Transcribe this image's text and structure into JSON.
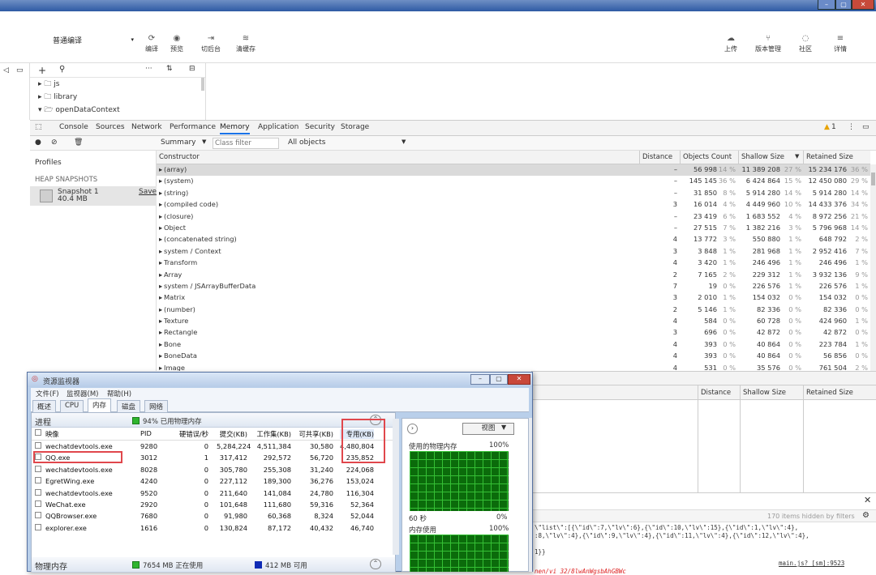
{
  "titlebar": {
    "min": "–",
    "max": "▢",
    "close": "✕"
  },
  "toolbar": {
    "compile_mode": "普通编译",
    "buttons": [
      {
        "label": "编译",
        "icon": "refresh-icon"
      },
      {
        "label": "预览",
        "icon": "eye-icon"
      },
      {
        "label": "切后台",
        "icon": "switch-icon"
      },
      {
        "label": "清缓存",
        "icon": "layers-icon"
      }
    ],
    "right_buttons": [
      {
        "label": "上传",
        "icon": "cloud-upload-icon"
      },
      {
        "label": "版本管理",
        "icon": "branch-icon"
      },
      {
        "label": "社区",
        "icon": "chat-icon"
      },
      {
        "label": "详情",
        "icon": "menu-icon"
      }
    ]
  },
  "filetree": {
    "items": [
      "js",
      "library",
      "openDataContext"
    ]
  },
  "devtools": {
    "tabs": [
      "Console",
      "Sources",
      "Network",
      "Performance",
      "Memory",
      "Application",
      "Security",
      "Storage"
    ],
    "active_tab": "Memory",
    "warnings": "1"
  },
  "profiles": {
    "title": "Profiles",
    "section": "HEAP SNAPSHOTS",
    "snapshot_name": "Snapshot 1",
    "snapshot_size": "40.4 MB",
    "save": "Save"
  },
  "filter": {
    "view": "Summary",
    "placeholder": "Class filter",
    "objects": "All objects"
  },
  "heap": {
    "headers": [
      "Constructor",
      "Distance",
      "Objects Count",
      "Shallow Size",
      "Retained Size"
    ],
    "rows": [
      [
        "(array)",
        "–",
        "56 998",
        "14 %",
        "11 389 208",
        "27 %",
        "15 234 176",
        "36 %"
      ],
      [
        "(system)",
        "–",
        "145 145",
        "36 %",
        "6 424 864",
        "15 %",
        "12 450 080",
        "29 %"
      ],
      [
        "(string)",
        "–",
        "31 850",
        "8 %",
        "5 914 280",
        "14 %",
        "5 914 280",
        "14 %"
      ],
      [
        "(compiled code)",
        "3",
        "16 014",
        "4 %",
        "4 449 960",
        "10 %",
        "14 433 376",
        "34 %"
      ],
      [
        "(closure)",
        "–",
        "23 419",
        "6 %",
        "1 683 552",
        "4 %",
        "8 972 256",
        "21 %"
      ],
      [
        "Object",
        "–",
        "27 515",
        "7 %",
        "1 382 216",
        "3 %",
        "5 796 968",
        "14 %"
      ],
      [
        "(concatenated string)",
        "4",
        "13 772",
        "3 %",
        "550 880",
        "1 %",
        "648 792",
        "2 %"
      ],
      [
        "system / Context",
        "3",
        "3 848",
        "1 %",
        "281 968",
        "1 %",
        "2 952 416",
        "7 %"
      ],
      [
        "Transform",
        "4",
        "3 420",
        "1 %",
        "246 496",
        "1 %",
        "246 496",
        "1 %"
      ],
      [
        "Array",
        "2",
        "7 165",
        "2 %",
        "229 312",
        "1 %",
        "3 932 136",
        "9 %"
      ],
      [
        "system / JSArrayBufferData",
        "7",
        "19",
        "0 %",
        "226 576",
        "1 %",
        "226 576",
        "1 %"
      ],
      [
        "Matrix",
        "3",
        "2 010",
        "1 %",
        "154 032",
        "0 %",
        "154 032",
        "0 %"
      ],
      [
        "(number)",
        "2",
        "5 146",
        "1 %",
        "82 336",
        "0 %",
        "82 336",
        "0 %"
      ],
      [
        "Texture",
        "4",
        "584",
        "0 %",
        "60 728",
        "0 %",
        "424 960",
        "1 %"
      ],
      [
        "Rectangle",
        "3",
        "696",
        "0 %",
        "42 872",
        "0 %",
        "42 872",
        "0 %"
      ],
      [
        "Bone",
        "4",
        "393",
        "0 %",
        "40 864",
        "0 %",
        "223 784",
        "1 %"
      ],
      [
        "BoneData",
        "4",
        "393",
        "0 %",
        "40 864",
        "0 %",
        "56 856",
        "0 %"
      ],
      [
        "Image",
        "4",
        "531",
        "0 %",
        "35 576",
        "0 %",
        "761 504",
        "2 %"
      ]
    ]
  },
  "retainers": {
    "headers": [
      "Distance",
      "Shallow Size",
      "Retained Size"
    ]
  },
  "console": {
    "hidden": "170 items hidden by filters",
    "lines": [
      "\\\"list\\\":[{\\\"id\\\":7,\\\"lv\\\":6},{\\\"id\\\":10,\\\"lv\\\":15},{\\\"id\\\":1,\\\"lv\\\":4},",
      ":8,\\\"lv\\\":4},{\\\"id\\\":9,\\\"lv\\\":4},{\\\"id\\\":11,\\\"lv\\\":4},{\\\"id\\\":12,\\\"lv\\\":4},",
      "1}}"
    ],
    "source": "main.js? [sm]:9523",
    "error": "nen/vi 32/8lwAnWgsbAhGBWc"
  },
  "resmon": {
    "title": "资源监视器",
    "menu": [
      "文件(F)",
      "监视器(M)",
      "帮助(H)"
    ],
    "tabs": [
      "概述",
      "CPU",
      "内存",
      "磁盘",
      "网络"
    ],
    "active_tab": "内存",
    "section_title": "进程",
    "usage": "94% 已用物理内存",
    "columns": [
      "映像",
      "PID",
      "硬错误/秒",
      "提交(KB)",
      "工作集(KB)",
      "可共享(KB)",
      "专用(KB)"
    ],
    "processes": [
      [
        "wechatdevtools.exe",
        "9280",
        "0",
        "5,284,224",
        "4,511,384",
        "30,580",
        "4,480,804"
      ],
      [
        "QQ.exe",
        "3012",
        "1",
        "317,412",
        "292,572",
        "56,720",
        "235,852"
      ],
      [
        "wechatdevtools.exe",
        "8028",
        "0",
        "305,780",
        "255,308",
        "31,240",
        "224,068"
      ],
      [
        "EgretWing.exe",
        "4240",
        "0",
        "227,112",
        "189,300",
        "36,276",
        "153,024"
      ],
      [
        "wechatdevtools.exe",
        "9520",
        "0",
        "211,640",
        "141,084",
        "24,780",
        "116,304"
      ],
      [
        "WeChat.exe",
        "2920",
        "0",
        "101,648",
        "111,680",
        "59,316",
        "52,364"
      ],
      [
        "QQBrowser.exe",
        "7680",
        "0",
        "91,980",
        "60,368",
        "8,324",
        "52,044"
      ],
      [
        "explorer.exe",
        "1616",
        "0",
        "130,824",
        "87,172",
        "40,432",
        "46,740"
      ]
    ],
    "phys_title": "物理内存",
    "in_use": "7654 MB 正在使用",
    "available": "412 MB 可用",
    "view": "视图",
    "graph1_title": "使用的物理内存",
    "graph1_pct": "100%",
    "graph1_time": "60 秒",
    "graph1_low": "0%",
    "graph2_title": "内存使用",
    "graph2_pct": "100%"
  }
}
